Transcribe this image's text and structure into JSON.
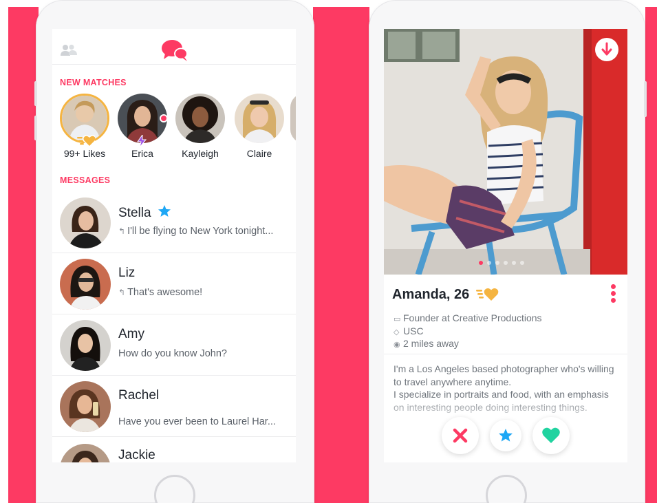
{
  "colors": {
    "brand": "#fd3a63",
    "gold": "#f5b440",
    "superlike": "#1ea7f5",
    "like": "#21d3a0"
  },
  "left_screen": {
    "header": {
      "left_icon": "people-icon",
      "center_icon": "chat-bubbles-icon"
    },
    "new_matches_label": "NEW MATCHES",
    "matches": [
      {
        "name": "99+ Likes",
        "badge": "gold-heart-icon"
      },
      {
        "name": "Erica",
        "badge": "boost-bolt-icon"
      },
      {
        "name": "Kayleigh"
      },
      {
        "name": "Claire"
      }
    ],
    "messages_label": "MESSAGES",
    "messages": [
      {
        "name": "Stella",
        "text": "I'll be flying to New York tonight...",
        "replied": true,
        "badge": "superlike-star-icon"
      },
      {
        "name": "Liz",
        "text": "That's awesome!",
        "replied": true
      },
      {
        "name": "Amy",
        "text": "How do you know John?",
        "replied": false
      },
      {
        "name": "Rachel",
        "text": "Have you ever been to Laurel Har...",
        "replied": false
      },
      {
        "name": "Jackie",
        "text": "",
        "replied": false
      }
    ]
  },
  "right_screen": {
    "photo_count": 6,
    "active_photo": 1,
    "name_age": "Amanda, 26",
    "job": "Founder at Creative Productions",
    "school": "USC",
    "distance": "2 miles away",
    "bio": "I'm a Los Angeles based photographer who's willing to travel anywhere anytime.\nI specialize in portraits and food, with an emphasis on interesting people doing interesting things.",
    "actions": [
      "nope-x-icon",
      "superlike-star-icon",
      "like-heart-icon"
    ]
  }
}
